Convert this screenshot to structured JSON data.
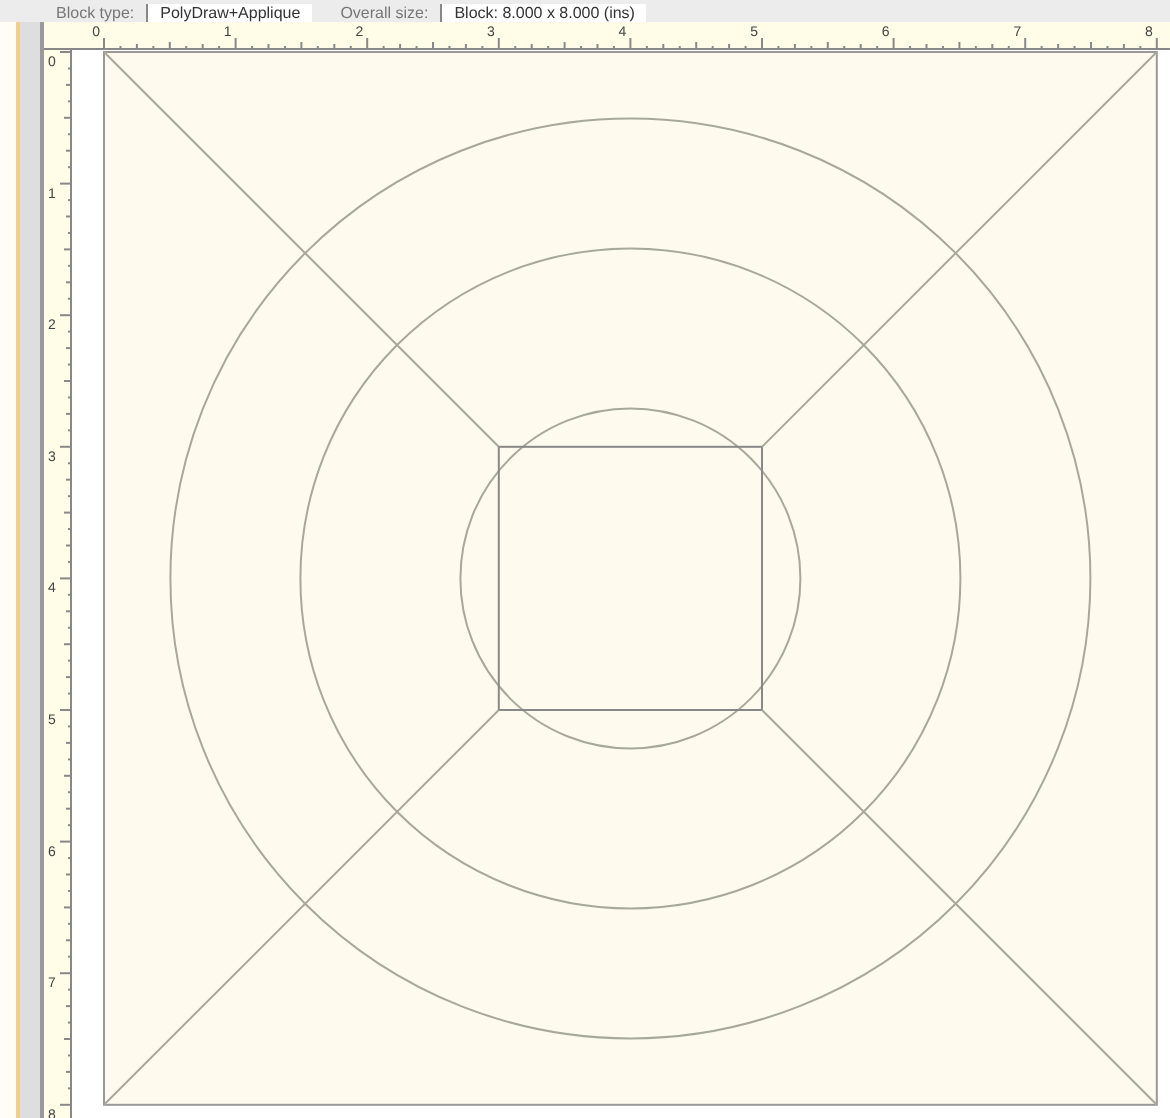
{
  "toolbar": {
    "fields": [
      {
        "label": "Block type:",
        "value": "PolyDraw+Applique"
      },
      {
        "label": "Overall size:",
        "value": "Block: 8.000 x 8.000 (ins)"
      }
    ]
  },
  "rulers": {
    "horizontal_labels": [
      "0",
      "1",
      "2",
      "3",
      "4",
      "5",
      "6",
      "7",
      "8"
    ],
    "vertical_labels": [
      "0",
      "1",
      "2",
      "3",
      "4",
      "5",
      "6",
      "7",
      "8"
    ]
  }
}
